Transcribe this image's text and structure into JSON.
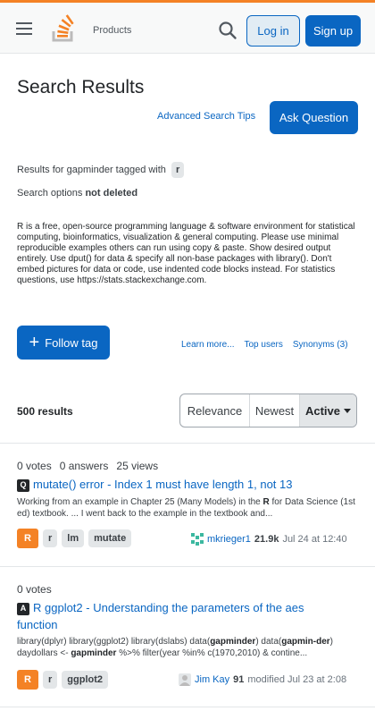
{
  "header": {
    "products": "Products",
    "login": "Log in",
    "signup": "Sign up"
  },
  "page": {
    "title": "Search Results",
    "advanced_tips": "Advanced Search Tips",
    "ask_question": "Ask Question",
    "results_for_prefix": "Results for gapminder tagged with",
    "results_for_tag": "r",
    "search_options_prefix": "Search options",
    "search_options_value": "not deleted",
    "tag_description": "R is a free, open-source programming language & software environment for statistical computing, bioinformatics, visualization & general computing. Please use minimal reproducible examples others can run using copy & paste. Show desired output entirely. Use dput() for data & specify all non-base packages with library(). Don't embed pictures for data or code, use indented code blocks instead. For statistics questions, use https://stats.stackexchange.com.",
    "follow_tag": "Follow tag",
    "learn_more": "Learn more...",
    "top_users": "Top users",
    "synonyms": "Synonyms (3)",
    "results_count": "500 results",
    "sort": {
      "relevance": "Relevance",
      "newest": "Newest",
      "active": "Active"
    }
  },
  "results": [
    {
      "votes": "0 votes",
      "answers": "0 answers",
      "views": "25 views",
      "badge": "Q",
      "title": "mutate() error - Index 1 must have length 1, not 13",
      "excerpt_pre": "Working from an example in Chapter 25 (Many Models) in the ",
      "excerpt_bold": "R",
      "excerpt_post": " for Data Science (1st ed) textbook. ... I went back to the example in the textbook and...",
      "tags": [
        "R",
        "r",
        "lm",
        "mutate"
      ],
      "user": "mkrieger1",
      "rep": "21.9k",
      "time": "Jul 24 at 12:40"
    },
    {
      "votes": "0 votes",
      "badge": "A",
      "title": "R ggplot2 - Understanding the parameters of the aes function",
      "excerpt_a": "library(dplyr) library(ggplot2) library(dslabs) data(",
      "excerpt_b1": "gapminder",
      "excerpt_c": ") data(",
      "excerpt_b2": "gapmin-der",
      "excerpt_d": ") daydollars <- ",
      "excerpt_b3": "gapminder",
      "excerpt_e": " %>% filter(year %in% c(1970,2010) & contine...",
      "tags": [
        "R",
        "r",
        "ggplot2"
      ],
      "user": "Jim Kay",
      "rep": "91",
      "time": "modified Jul 23 at 2:08"
    }
  ],
  "colors": {
    "accent": "#0a66c2",
    "brand_orange": "#f48225"
  }
}
